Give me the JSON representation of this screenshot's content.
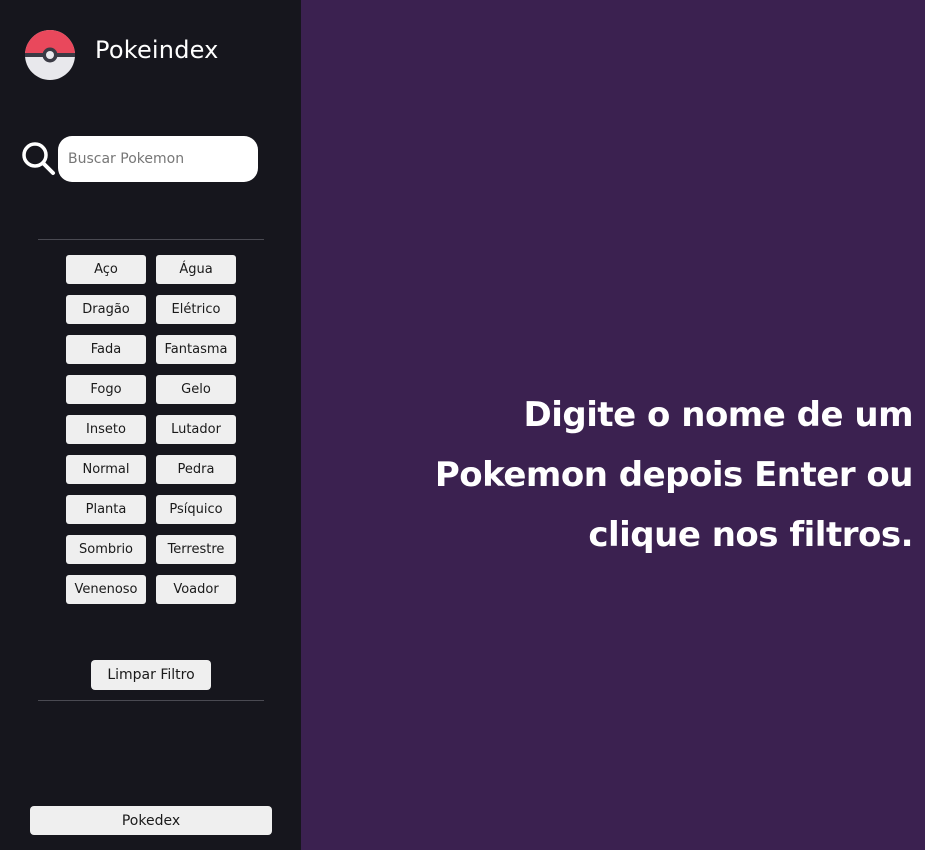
{
  "app": {
    "title": "Pokeindex"
  },
  "search": {
    "placeholder": "Buscar Pokemon"
  },
  "filters": {
    "types": [
      "Aço",
      "Água",
      "Dragão",
      "Elétrico",
      "Fada",
      "Fantasma",
      "Fogo",
      "Gelo",
      "Inseto",
      "Lutador",
      "Normal",
      "Pedra",
      "Planta",
      "Psíquico",
      "Sombrio",
      "Terrestre",
      "Venenoso",
      "Voador"
    ],
    "clear_label": "Limpar Filtro"
  },
  "footer": {
    "pokedex_label": "Pokedex"
  },
  "main": {
    "message": "Digite o nome de um Pokemon depois Enter ou clique nos filtros."
  },
  "colors": {
    "sidebar_bg": "#16161d",
    "main_bg": "#3b2150",
    "pokeball_red": "#e9485c",
    "button_bg": "#efefef"
  },
  "icons": {
    "logo": "pokeball-icon",
    "search": "search-icon"
  }
}
